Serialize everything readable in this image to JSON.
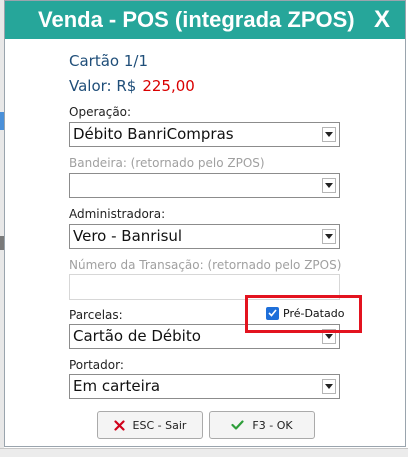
{
  "dialog": {
    "title": "Venda - POS (integrada ZPOS)",
    "close_label": "X"
  },
  "card": {
    "header": "Cartão 1/1",
    "value_label": "Valor: R$",
    "value_amount": "225,00"
  },
  "fields": {
    "operacao": {
      "label": "Operação:",
      "value": "Débito BanriCompras"
    },
    "bandeira": {
      "label": "Bandeira: (retornado pelo ZPOS)",
      "value": ""
    },
    "administradora": {
      "label": "Administradora:",
      "value": "Vero - Banrisul"
    },
    "numero_transacao": {
      "label": "Número da Transação: (retornado pelo ZPOS)",
      "value": ""
    },
    "parcelas": {
      "label": "Parcelas:",
      "value": "Cartão de Débito"
    },
    "portador": {
      "label": "Portador:",
      "value": "Em carteira"
    }
  },
  "pre_datado": {
    "label": "Pré-Datado",
    "checked": true
  },
  "buttons": {
    "cancel": {
      "label": "ESC - Sair",
      "icon": "x-icon"
    },
    "ok": {
      "label": "F3 - OK",
      "icon": "check-icon"
    }
  },
  "colors": {
    "titlebar": "#26a69a",
    "value_amount": "#d90000",
    "highlight": "#e3131f",
    "checkbox": "#1e6fd9",
    "cancel_icon": "#d0021b",
    "ok_icon": "#2e9e3a"
  }
}
